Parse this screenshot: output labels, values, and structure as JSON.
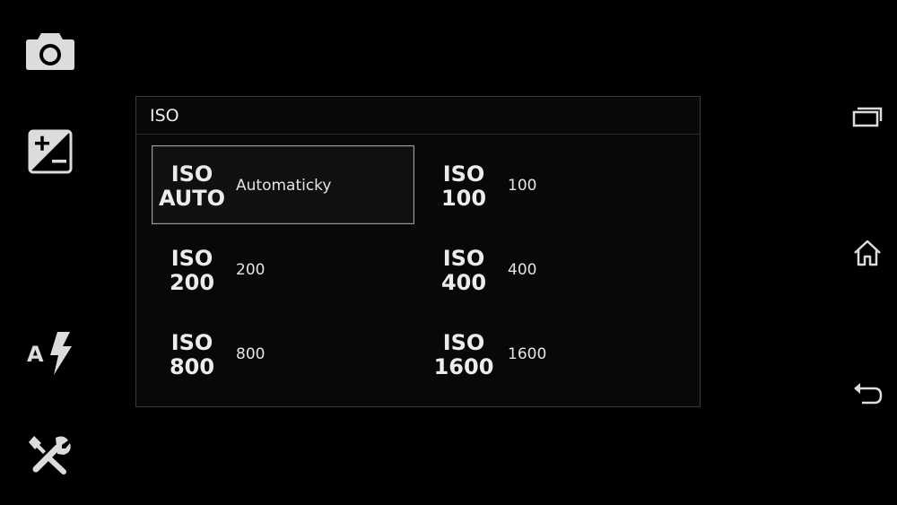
{
  "left_toolbar": {
    "items": [
      {
        "icon": "camera-icon"
      },
      {
        "icon": "exposure-compensation-icon"
      },
      {
        "icon": "auto-flash-icon",
        "badge": "A"
      },
      {
        "icon": "settings-tools-icon"
      }
    ]
  },
  "dialog": {
    "title": "ISO",
    "selected": "auto",
    "options": [
      {
        "id": "auto",
        "badge_top": "ISO",
        "badge_bottom": "AUTO",
        "label": "Automaticky"
      },
      {
        "id": "100",
        "badge_top": "ISO",
        "badge_bottom": "100",
        "label": "100"
      },
      {
        "id": "200",
        "badge_top": "ISO",
        "badge_bottom": "200",
        "label": "200"
      },
      {
        "id": "400",
        "badge_top": "ISO",
        "badge_bottom": "400",
        "label": "400"
      },
      {
        "id": "800",
        "badge_top": "ISO",
        "badge_bottom": "800",
        "label": "800"
      },
      {
        "id": "1600",
        "badge_top": "ISO",
        "badge_bottom": "1600",
        "label": "1600"
      }
    ]
  },
  "nav_bar": {
    "items": [
      {
        "icon": "recent-apps-icon"
      },
      {
        "icon": "home-icon"
      },
      {
        "icon": "back-icon"
      }
    ]
  },
  "colors": {
    "background": "#000000",
    "icon": "#e0e0e0",
    "dialog_border": "#3a3a3a",
    "selected_border": "#9a9a9a"
  }
}
